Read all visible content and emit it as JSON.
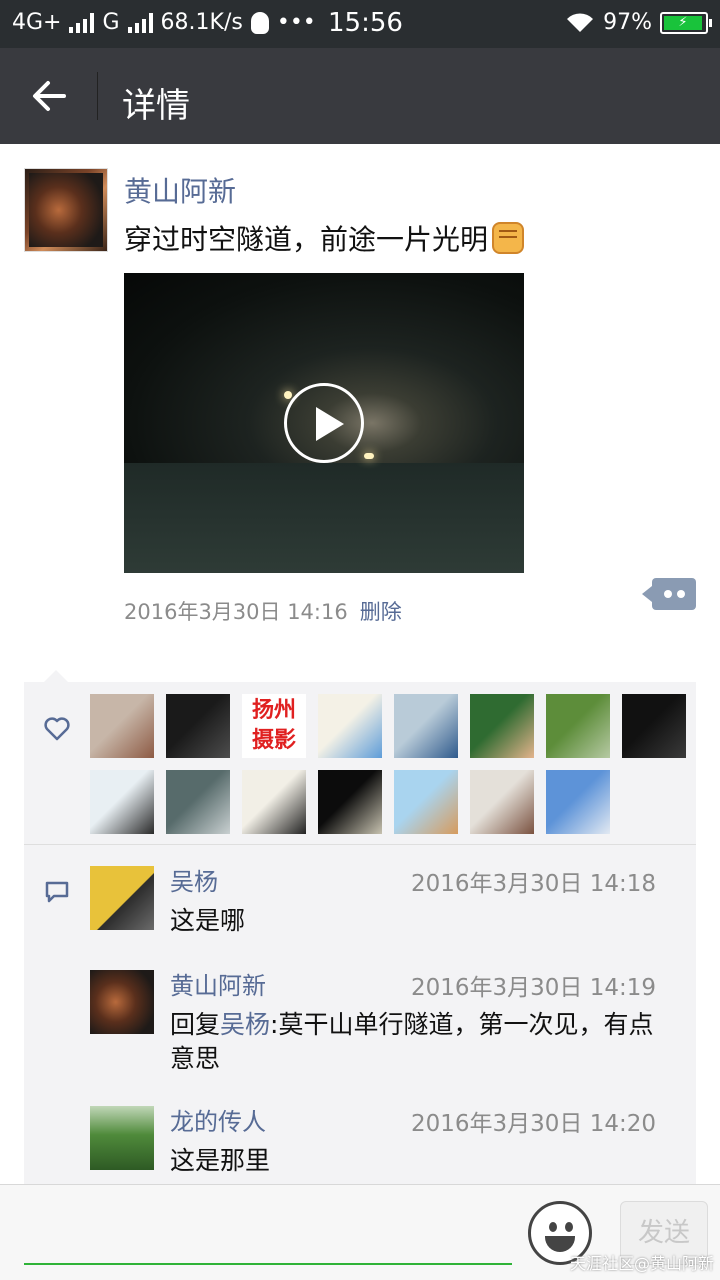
{
  "status_bar": {
    "network": "4G+",
    "network2": "G",
    "speed": "68.1K/s",
    "time": "15:56",
    "battery": "97%",
    "more": "•••"
  },
  "header": {
    "title": "详情"
  },
  "post": {
    "author": "黄山阿新",
    "text": "穿过时空隧道，前途一片光明",
    "timestamp": "2016年3月30日 14:16",
    "delete_label": "删除"
  },
  "likes": {
    "avatars": [
      {
        "name": "like-avatar-1",
        "c1": "#c7b6a8",
        "c2": "#8d5a44"
      },
      {
        "name": "like-avatar-2",
        "c1": "#1a1a1a",
        "c2": "#4d4d4d"
      },
      {
        "name": "like-avatar-3",
        "c1": "#ffffff",
        "c2": "#e02020",
        "text": "扬州摄影"
      },
      {
        "name": "like-avatar-4",
        "c1": "#f4f1e6",
        "c2": "#5e9cd8"
      },
      {
        "name": "like-avatar-5",
        "c1": "#b9cbd8",
        "c2": "#2f5a8c"
      },
      {
        "name": "like-avatar-6",
        "c1": "#2f6b31",
        "c2": "#e3b38c"
      },
      {
        "name": "like-avatar-7",
        "c1": "#5d8d3a",
        "c2": "#b6c9a3"
      },
      {
        "name": "like-avatar-8",
        "c1": "#111111",
        "c2": "#3a3a3a"
      },
      {
        "name": "like-avatar-9",
        "c1": "#e8eff3",
        "c2": "#2a2a2a"
      },
      {
        "name": "like-avatar-10",
        "c1": "#576b6b",
        "c2": "#c9d0d1"
      },
      {
        "name": "like-avatar-11",
        "c1": "#f2efe6",
        "c2": "#222222"
      },
      {
        "name": "like-avatar-12",
        "c1": "#0c0c0c",
        "c2": "#c7c2b0"
      },
      {
        "name": "like-avatar-13",
        "c1": "#a9d4ef",
        "c2": "#d69b5e"
      },
      {
        "name": "like-avatar-14",
        "c1": "#e4e0d9",
        "c2": "#7a5240"
      },
      {
        "name": "like-avatar-15",
        "c1": "#5d93d8",
        "c2": "#e2e9f2"
      }
    ]
  },
  "comments": [
    {
      "author": "吴杨",
      "time": "2016年3月30日 14:18",
      "text": "这是哪",
      "reply_to": "",
      "c1": "#e8c23a",
      "c2": "#2c2c2c"
    },
    {
      "author": "黄山阿新",
      "time": "2016年3月30日 14:19",
      "prefix": "回复",
      "reply_to": "吴杨",
      "text": ":莫干山单行隧道，第一次见，有点意思",
      "c1": "#7a4328",
      "c2": "#1e1a18"
    },
    {
      "author": "龙的传人",
      "time": "2016年3月30日 14:20",
      "text": "这是那里",
      "reply_to": "",
      "c1": "#4f8a3b",
      "c2": "#c1d7b8"
    }
  ],
  "input": {
    "send_label": "发送",
    "watermark": "天涯社区@黄山阿新"
  },
  "colors": {
    "link": "#576b95",
    "header_bg": "#393a3f",
    "accent": "#2fb338"
  }
}
